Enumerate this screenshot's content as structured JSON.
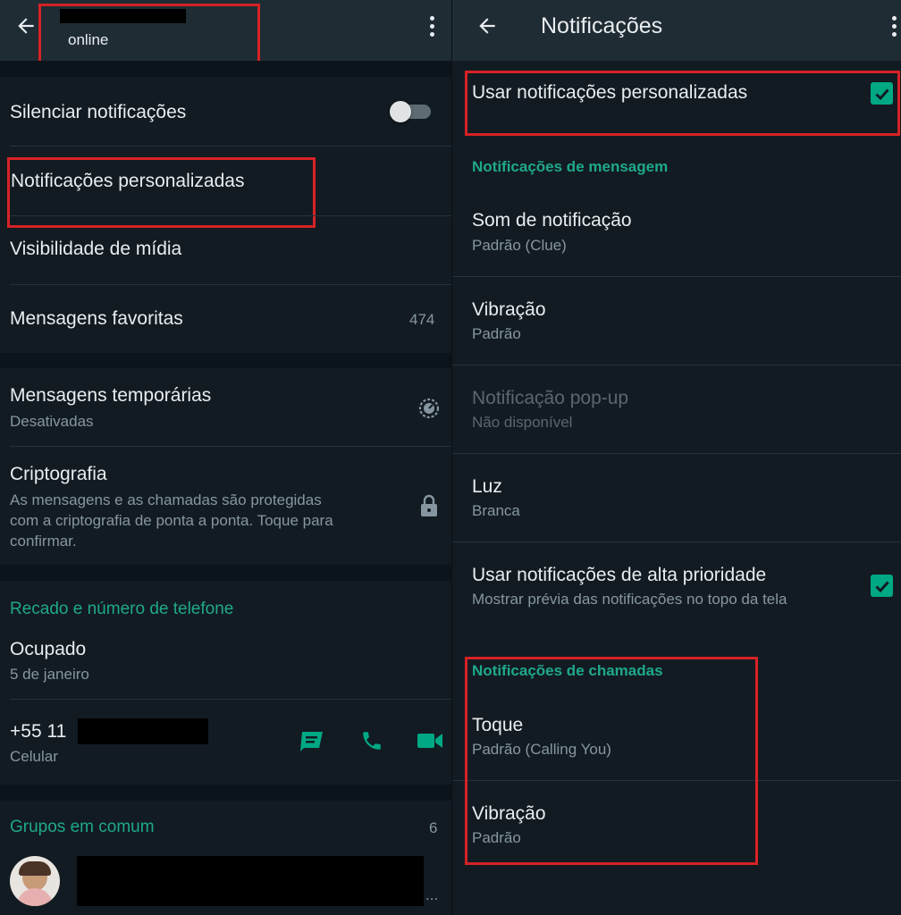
{
  "left": {
    "header": {
      "status": "online"
    },
    "items": {
      "mute": {
        "title": "Silenciar notificações",
        "enabled": false
      },
      "custom_notifications": {
        "title": "Notificações personalizadas"
      },
      "media_visibility": {
        "title": "Visibilidade de mídia"
      },
      "starred": {
        "title": "Mensagens favoritas",
        "count": "474"
      },
      "disappearing": {
        "title": "Mensagens temporárias",
        "subtitle": "Desativadas"
      },
      "encryption": {
        "title": "Criptografia",
        "subtitle_lines": [
          "As mensagens e as chamadas são protegidas",
          "com a criptografia de ponta a ponta. Toque para",
          "confirmar."
        ]
      }
    },
    "about_section": {
      "header": "Recado e número de telefone",
      "about": {
        "title": "Ocupado",
        "date": "5 de janeiro"
      },
      "phone": {
        "number_prefix": "+55 11",
        "label": "Celular"
      }
    },
    "groups_section": {
      "header": "Grupos em comum",
      "count": "6",
      "ellipsis": "..."
    }
  },
  "right": {
    "header": {
      "title": "Notificações"
    },
    "use_custom": {
      "label": "Usar notificações personalizadas",
      "checked": true
    },
    "message_section": {
      "header": "Notificações de mensagem",
      "sound": {
        "title": "Som de notificação",
        "value": "Padrão (Clue)"
      },
      "vibration": {
        "title": "Vibração",
        "value": "Padrão"
      },
      "popup": {
        "title": "Notificação pop-up",
        "value": "Não disponível"
      },
      "light": {
        "title": "Luz",
        "value": "Branca"
      },
      "high_priority": {
        "title": "Usar notificações de alta prioridade",
        "value": "Mostrar prévia das notificações no topo da tela",
        "checked": true
      }
    },
    "call_section": {
      "header": "Notificações de chamadas",
      "ringtone": {
        "title": "Toque",
        "value": "Padrão (Calling You)"
      },
      "vibration": {
        "title": "Vibração",
        "value": "Padrão"
      }
    }
  },
  "colors": {
    "background": "#121b22",
    "appbar": "#1f2c34",
    "accent": "#00a884",
    "section_header": "#21c063",
    "highlight_box": "#d62226"
  }
}
